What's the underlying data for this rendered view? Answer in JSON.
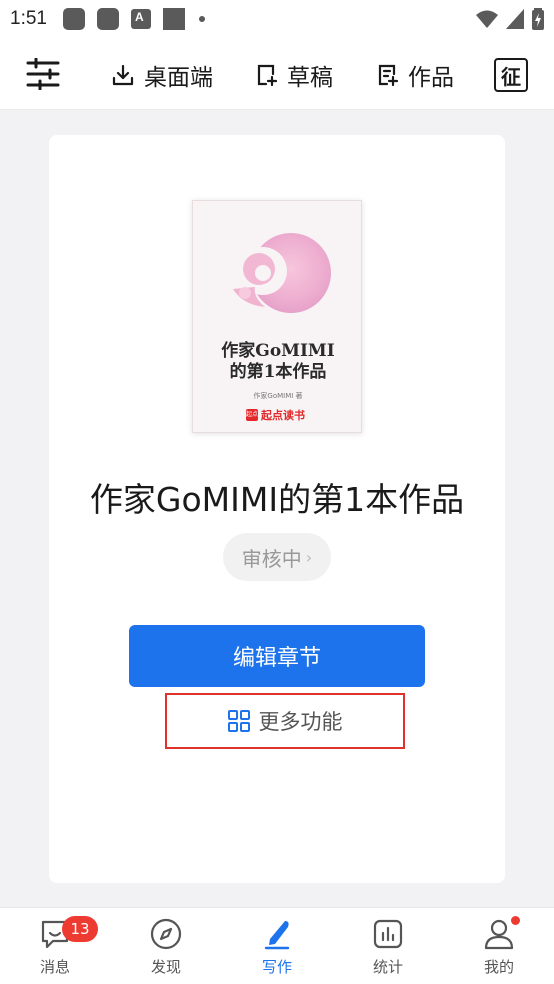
{
  "status_bar": {
    "time": "1:51"
  },
  "top_nav": {
    "desktop_label": "桌面端",
    "draft_label": "草稿",
    "works_label": "作品",
    "zheng_label": "征"
  },
  "book": {
    "cover_title_line1": "作家GoMIMI",
    "cover_title_line2": "的第1本作品",
    "cover_author": "作家GoMIMI 著",
    "cover_brand": "起点读书",
    "title": "作家GoMIMI的第1本作品",
    "status": "审核中"
  },
  "actions": {
    "edit_label": "编辑章节",
    "more_label": "更多功能"
  },
  "tab_bar": {
    "tabs": [
      {
        "label": "消息",
        "icon": "message-icon",
        "badge": "13"
      },
      {
        "label": "发现",
        "icon": "compass-icon"
      },
      {
        "label": "写作",
        "icon": "pen-icon",
        "active": true
      },
      {
        "label": "统计",
        "icon": "chart-icon"
      },
      {
        "label": "我的",
        "icon": "person-icon",
        "dot": true
      }
    ]
  },
  "colors": {
    "accent": "#1d73ec",
    "badge_red": "#ee3b32",
    "highlight_border": "#e0322c"
  }
}
